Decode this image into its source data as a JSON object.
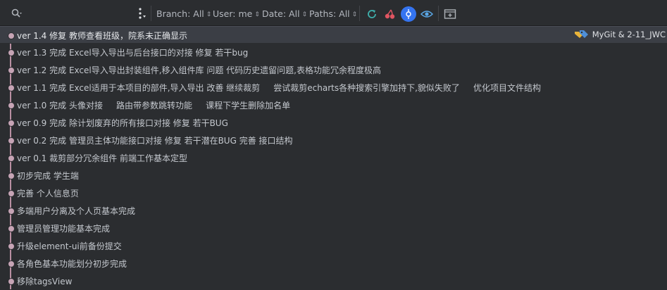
{
  "toolbar": {
    "search_placeholder": "",
    "filters": {
      "branch": "Branch: All",
      "user": "User: me",
      "date": "Date: All",
      "paths": "Paths: All"
    }
  },
  "log": {
    "commits": [
      {
        "message": "ver 1.4 修复 教师查看班级，院系未正确显示",
        "ref": "MyGit & 2-11_JWC",
        "selected": true
      },
      {
        "message": "ver 1.3 完成 Excel导入导出与后台接口的对接 修复 若干bug"
      },
      {
        "message": "ver 1.2 完成 Excel导入导出封装组件,移入组件库 问题 代码历史遗留问题,表格功能冗余程度极高"
      },
      {
        "message": "ver 1.1 完成 Excel适用于本项目的部件,导入导出 改善 继续裁剪     尝试裁剪echarts各种搜索引擎加持下,貌似失败了     优化项目文件结构"
      },
      {
        "message": "ver 1.0 完成 头像对接     路由带参数跳转功能     课程下学生删除加名单"
      },
      {
        "message": "ver 0.9 完成 除计划废弃的所有接口对接 修复 若干BUG"
      },
      {
        "message": "ver 0.2 完成 管理员主体功能接口对接 修复 若干潜在BUG 完善 接口结构"
      },
      {
        "message": "ver 0.1 裁剪部分冗余组件 前端工作基本定型"
      },
      {
        "message": "初步完成 学生端"
      },
      {
        "message": "完善 个人信息页"
      },
      {
        "message": "多端用户分离及个人页基本完成"
      },
      {
        "message": "管理员管理功能基本完成"
      },
      {
        "message": "升级element-ui前备份提交"
      },
      {
        "message": "各角色基本功能划分初步完成"
      },
      {
        "message": "移除tagsView"
      }
    ]
  },
  "icons": {
    "search": "search-icon",
    "kebab": "more-vertical-icon",
    "refresh": "refresh-icon",
    "cherry_pick": "cherry-pick-icon",
    "highlight": "highlight-commit-icon",
    "show_details": "eye-icon",
    "open_new_tab": "open-tab-icon",
    "tag": "branch-tag-icon"
  },
  "colors": {
    "graph": "#b98fa2",
    "accent": "#3574f0",
    "refresh": "#3fb1ad",
    "cherry": "#e05561"
  }
}
